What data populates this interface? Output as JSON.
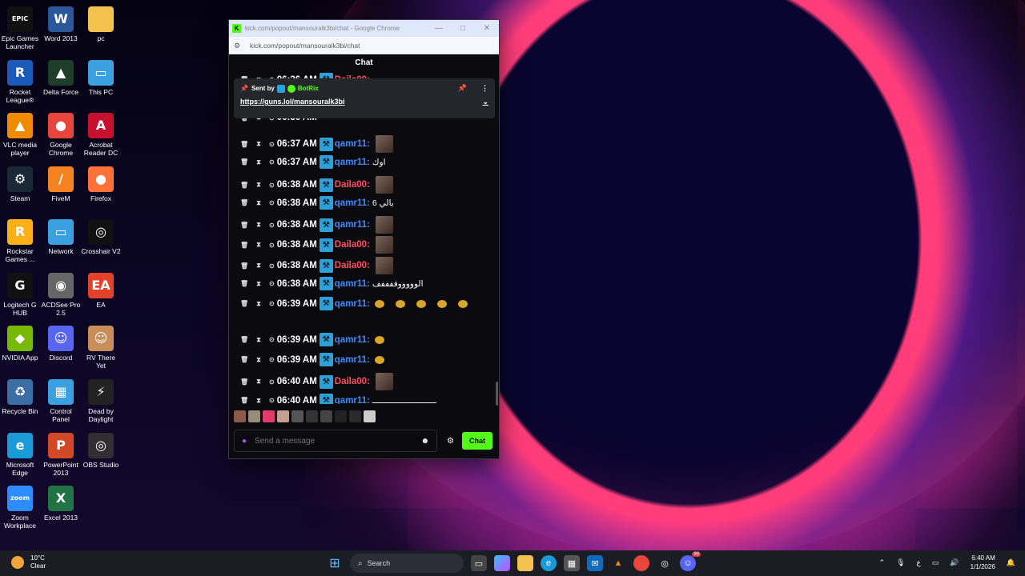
{
  "desktop": {
    "icons": [
      {
        "label": "Epic Games Launcher",
        "color": "#111111",
        "glyph": "EPIC"
      },
      {
        "label": "Word 2013",
        "color": "#2b579a",
        "glyph": "W"
      },
      {
        "label": "pc",
        "color": "#f2c14e",
        "glyph": ""
      },
      {
        "label": "Rocket League®",
        "color": "#1b5ab8",
        "glyph": "R"
      },
      {
        "label": "Delta Force",
        "color": "#1f3d2b",
        "glyph": "▲"
      },
      {
        "label": "This PC",
        "color": "#3aa0e0",
        "glyph": "▭"
      },
      {
        "label": "VLC media player",
        "color": "#f08a00",
        "glyph": "▲"
      },
      {
        "label": "Google Chrome",
        "color": "#e8453c",
        "glyph": "●"
      },
      {
        "label": "Acrobat Reader DC",
        "color": "#c8102e",
        "glyph": "A"
      },
      {
        "label": "Steam",
        "color": "#1b2838",
        "glyph": "⚙"
      },
      {
        "label": "FiveM",
        "color": "#f58220",
        "glyph": "/"
      },
      {
        "label": "Firefox",
        "color": "#ff7139",
        "glyph": "●"
      },
      {
        "label": "Rockstar Games ...",
        "color": "#fcaf17",
        "glyph": "R"
      },
      {
        "label": "Network",
        "color": "#3aa0e0",
        "glyph": "▭"
      },
      {
        "label": "Crosshair V2",
        "color": "#111111",
        "glyph": "◎"
      },
      {
        "label": "Logitech G HUB",
        "color": "#111111",
        "glyph": "G"
      },
      {
        "label": "ACDSee Pro 2.5",
        "color": "#666666",
        "glyph": "◉"
      },
      {
        "label": "EA",
        "color": "#e4412b",
        "glyph": "EA"
      },
      {
        "label": "NVIDIA App",
        "color": "#76b900",
        "glyph": "◆"
      },
      {
        "label": "Discord",
        "color": "#5865f2",
        "glyph": "☺"
      },
      {
        "label": "RV There Yet",
        "color": "#c98d5a",
        "glyph": "☺"
      },
      {
        "label": "Recycle Bin",
        "color": "#3a6ea5",
        "glyph": "♻"
      },
      {
        "label": "Control Panel",
        "color": "#3aa0e0",
        "glyph": "▦"
      },
      {
        "label": "Dead by Daylight",
        "color": "#222222",
        "glyph": "⚡"
      },
      {
        "label": "Microsoft Edge",
        "color": "#1a9ad6",
        "glyph": "e"
      },
      {
        "label": "PowerPoint 2013",
        "color": "#d24726",
        "glyph": "P"
      },
      {
        "label": "OBS Studio",
        "color": "#302e31",
        "glyph": "◎"
      },
      {
        "label": "Zoom Workplace",
        "color": "#2d8cff",
        "glyph": "zoom"
      },
      {
        "label": "Excel 2013",
        "color": "#217346",
        "glyph": "X"
      }
    ]
  },
  "browser": {
    "title": "kick.com/popout/mansouralk3bi/chat - Google Chrome",
    "url": "kick.com/popout/mansouralk3bi/chat",
    "controls": {
      "minimize": "—",
      "maximize": "□",
      "close": "✕"
    }
  },
  "chat": {
    "header": "Chat",
    "pinned": {
      "sent_by": "Sent by",
      "sender": "BotRix",
      "link": "https://guns.lol/mansouralk3bi"
    },
    "partial_top_time": "06:36 AM",
    "partial_top_user": "Daila00:",
    "partial_mid_time": "06:36 AM",
    "messages": [
      {
        "time": "06:37 AM",
        "user": "qamr11:",
        "color": "blue",
        "text": "",
        "emote": "img"
      },
      {
        "time": "06:37 AM",
        "user": "qamr11:",
        "color": "blue",
        "text": "اوك",
        "emote": ""
      },
      {
        "time": "06:38 AM",
        "user": "Daila00:",
        "color": "red",
        "text": "",
        "emote": "img"
      },
      {
        "time": "06:38 AM",
        "user": "qamr11:",
        "color": "blue",
        "text": "بالي 6",
        "emote": ""
      },
      {
        "time": "06:38 AM",
        "user": "qamr11:",
        "color": "blue",
        "text": "",
        "emote": "img"
      },
      {
        "time": "06:38 AM",
        "user": "Daila00:",
        "color": "red",
        "text": "",
        "emote": "img"
      },
      {
        "time": "06:38 AM",
        "user": "Daila00:",
        "color": "red",
        "text": "",
        "emote": "img"
      },
      {
        "time": "06:38 AM",
        "user": "qamr11:",
        "color": "blue",
        "text": "الوووووففففف",
        "emote": ""
      },
      {
        "time": "06:39 AM",
        "user": "qamr11:",
        "color": "blue",
        "text": "",
        "emote": "small5"
      },
      {
        "time": "06:39 AM",
        "user": "qamr11:",
        "color": "blue",
        "text": "",
        "emote": "small1"
      },
      {
        "time": "06:39 AM",
        "user": "qamr11:",
        "color": "blue",
        "text": "",
        "emote": "small1"
      },
      {
        "time": "06:40 AM",
        "user": "Daila00:",
        "color": "red",
        "text": "",
        "emote": "img"
      },
      {
        "time": "06:40 AM",
        "user": "qamr11:",
        "color": "blue",
        "text": "ــــــــــــــــــــــــــ",
        "emote": ""
      }
    ],
    "input_placeholder": "Send a message",
    "send_label": "Chat"
  },
  "taskbar": {
    "weather_temp": "10°C",
    "weather_desc": "Clear",
    "search_label": "Search",
    "time": "6:40 AM",
    "date": "1/1/2026",
    "discord_badge": "99"
  }
}
